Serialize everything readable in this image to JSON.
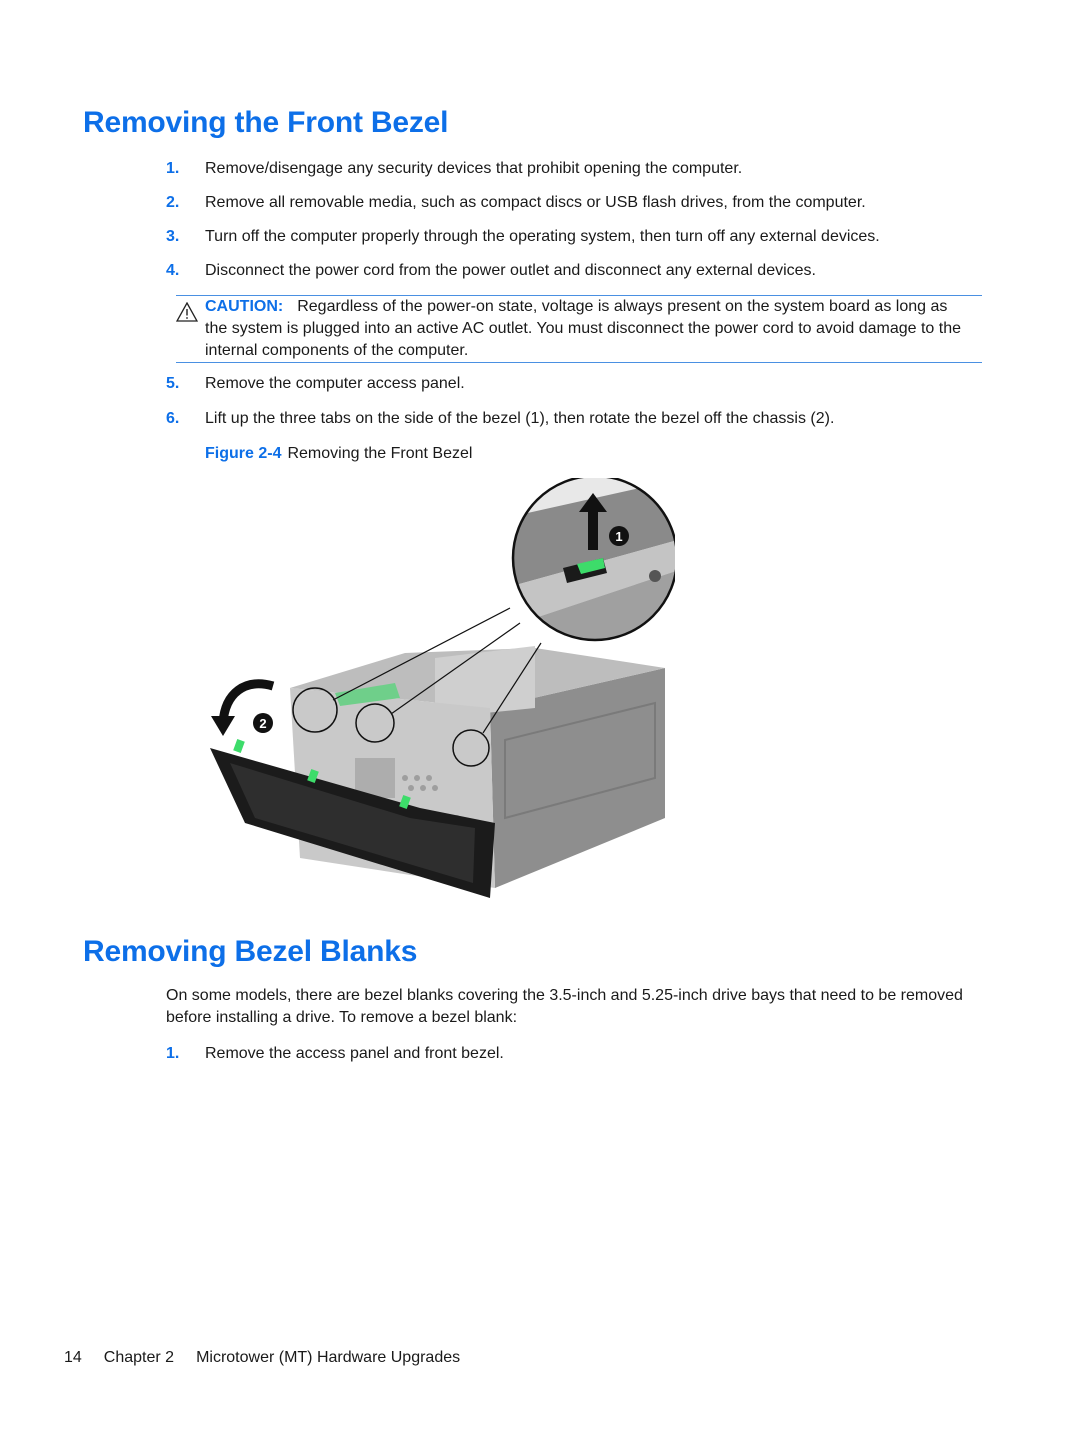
{
  "section1": {
    "title": "Removing the Front Bezel",
    "steps": [
      {
        "num": "1.",
        "text": "Remove/disengage any security devices that prohibit opening the computer."
      },
      {
        "num": "2.",
        "text": "Remove all removable media, such as compact discs or USB flash drives, from the computer."
      },
      {
        "num": "3.",
        "text": "Turn off the computer properly through the operating system, then turn off any external devices."
      },
      {
        "num": "4.",
        "text": "Disconnect the power cord from the power outlet and disconnect any external devices."
      },
      {
        "num": "5.",
        "text": "Remove the computer access panel."
      },
      {
        "num": "6.",
        "text": "Lift up the three tabs on the side of the bezel (1), then rotate the bezel off the chassis (2)."
      }
    ],
    "caution": {
      "label": "CAUTION:",
      "text": "Regardless of the power-on state, voltage is always present on the system board as long as the system is plugged into an active AC outlet. You must disconnect the power cord to avoid damage to the internal components of the computer."
    },
    "figure": {
      "label": "Figure 2-4",
      "caption": "Removing the Front Bezel",
      "callouts": [
        "1",
        "2"
      ]
    }
  },
  "section2": {
    "title": "Removing Bezel Blanks",
    "intro": "On some models, there are bezel blanks covering the 3.5-inch and 5.25-inch drive bays that need to be removed before installing a drive. To remove a bezel blank:",
    "steps": [
      {
        "num": "1.",
        "text": "Remove the access panel and front bezel."
      }
    ]
  },
  "footer": {
    "page_number": "14",
    "chapter": "Chapter 2",
    "chapter_title": "Microtower (MT) Hardware Upgrades"
  }
}
